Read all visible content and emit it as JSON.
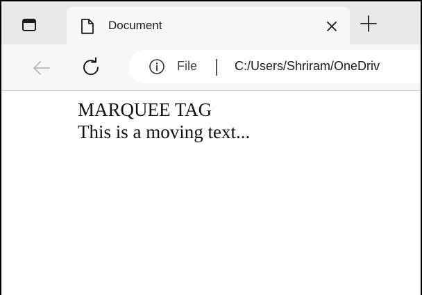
{
  "browser": {
    "tab": {
      "title": "Document"
    },
    "address_bar": {
      "site_label": "File",
      "url": "C:/Users/Shriram/OneDriv"
    },
    "icons": {
      "tab_actions": "tab-actions-icon",
      "tab_favicon": "document-icon",
      "tab_close": "close-icon",
      "new_tab": "plus-icon",
      "back": "arrow-left-icon",
      "refresh": "refresh-icon",
      "site_info": "info-icon"
    }
  },
  "page": {
    "heading": "MARQUEE TAG",
    "moving_text": "This is a moving text..."
  }
}
